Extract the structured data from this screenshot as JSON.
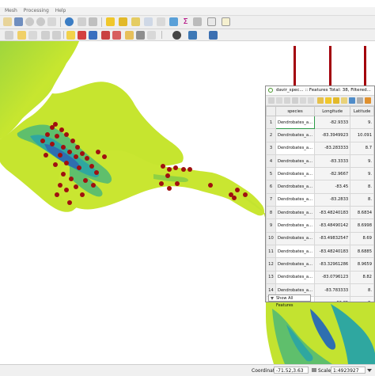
{
  "app": {
    "menu": [
      "Mesh",
      "Processing",
      "Help"
    ]
  },
  "map": {
    "colors": {
      "land_low": "#cfe92e",
      "land_mid": "#8ed144",
      "land_high": "#2fa7a0",
      "peaks": "#2e6fb0",
      "points": "#a01010",
      "arrows": "#a3000b"
    }
  },
  "attribute_table": {
    "title": "davir_spec... :: Features Total: 38, Filtered...",
    "columns": [
      "species",
      "Longitude",
      "Latitude"
    ],
    "rows": [
      {
        "n": "1",
        "species": "Dendrobates_a...",
        "lon": "-82.9333",
        "lat": "9."
      },
      {
        "n": "2",
        "species": "Dendrobates_a...",
        "lon": "-83.3949923",
        "lat": "10.091"
      },
      {
        "n": "3",
        "species": "Dendrobates_a...",
        "lon": "-83.283333",
        "lat": "8.7"
      },
      {
        "n": "4",
        "species": "Dendrobates_a...",
        "lon": "-83.3333",
        "lat": "9."
      },
      {
        "n": "5",
        "species": "Dendrobates_a...",
        "lon": "-82.9667",
        "lat": "9."
      },
      {
        "n": "6",
        "species": "Dendrobates_a...",
        "lon": "-83.45",
        "lat": "8."
      },
      {
        "n": "7",
        "species": "Dendrobates_a...",
        "lon": "-83.2833",
        "lat": "8."
      },
      {
        "n": "8",
        "species": "Dendrobates_a...",
        "lon": "-83.48240183",
        "lat": "8.6834"
      },
      {
        "n": "9",
        "species": "Dendrobates_a...",
        "lon": "-83.48490142",
        "lat": "8.6998"
      },
      {
        "n": "10",
        "species": "Dendrobates_a...",
        "lon": "-83.49832547",
        "lat": "8.69"
      },
      {
        "n": "11",
        "species": "Dendrobates_a...",
        "lon": "-83.48240183",
        "lat": "8.6885"
      },
      {
        "n": "12",
        "species": "Dendrobates_a...",
        "lon": "-83.32961286",
        "lat": "8.9659"
      },
      {
        "n": "13",
        "species": "Dendrobates_a...",
        "lon": "-83.0796123",
        "lat": "8.82"
      },
      {
        "n": "14",
        "species": "Dendrobates_a...",
        "lon": "-83.783333",
        "lat": "8."
      },
      {
        "n": "15",
        "species": "Dendrobates_a...",
        "lon": "-82.85",
        "lat": "8."
      },
      {
        "n": "16",
        "species": "Dendrobates_a...",
        "lon": "-77.167031",
        "lat": "7."
      },
      {
        "n": "17",
        "species": "Dendrobates_a...",
        "lon": "-83.27",
        "lat": "8."
      }
    ],
    "show_all_label": "Show All Features"
  },
  "status_bar": {
    "coordinate_label": "Coordinate",
    "coordinate_value": "-71.52,3.63",
    "scale_label": "Scale",
    "scale_value": "1:4923927"
  }
}
